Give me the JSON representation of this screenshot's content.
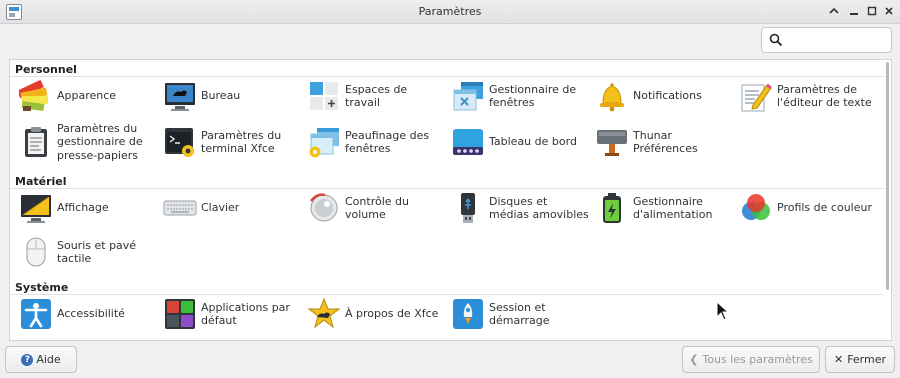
{
  "window": {
    "title": "Paramètres"
  },
  "search": {
    "placeholder": ""
  },
  "sections": [
    {
      "title": "Personnel",
      "items": [
        {
          "label": "Apparence",
          "icon": "appearance-icon"
        },
        {
          "label": "Bureau",
          "icon": "desktop-icon"
        },
        {
          "label": "Espaces de travail",
          "icon": "workspaces-icon"
        },
        {
          "label": "Gestionnaire de fenêtres",
          "icon": "window-manager-icon"
        },
        {
          "label": "Notifications",
          "icon": "bell-icon"
        },
        {
          "label": "Paramètres de l'éditeur de texte",
          "icon": "text-editor-icon"
        },
        {
          "label": "Paramètres du gestionnaire de presse-papiers",
          "icon": "clipboard-icon"
        },
        {
          "label": "Paramètres du terminal Xfce",
          "icon": "terminal-icon"
        },
        {
          "label": "Peaufinage des fenêtres",
          "icon": "window-tweaks-icon"
        },
        {
          "label": "Tableau de bord",
          "icon": "panel-icon"
        },
        {
          "label": "Thunar Préférences",
          "icon": "thunar-icon"
        }
      ]
    },
    {
      "title": "Matériel",
      "items": [
        {
          "label": "Affichage",
          "icon": "display-icon"
        },
        {
          "label": "Clavier",
          "icon": "keyboard-icon"
        },
        {
          "label": "Contrôle du volume",
          "icon": "volume-icon"
        },
        {
          "label": "Disques et médias amovibles",
          "icon": "usb-icon"
        },
        {
          "label": "Gestionnaire d'alimentation",
          "icon": "battery-icon"
        },
        {
          "label": "Profils de couleur",
          "icon": "color-profiles-icon"
        },
        {
          "label": "Souris et pavé tactile",
          "icon": "mouse-icon"
        }
      ]
    },
    {
      "title": "Système",
      "items": [
        {
          "label": "Accessibilité",
          "icon": "accessibility-icon"
        },
        {
          "label": "Applications par défaut",
          "icon": "default-apps-icon"
        },
        {
          "label": "À propos de Xfce",
          "icon": "about-xfce-icon"
        },
        {
          "label": "Session et démarrage",
          "icon": "session-rocket-icon"
        }
      ]
    }
  ],
  "footer": {
    "help_label": "Aide",
    "all_settings_label": "Tous les paramètres",
    "close_label": "Fermer"
  }
}
